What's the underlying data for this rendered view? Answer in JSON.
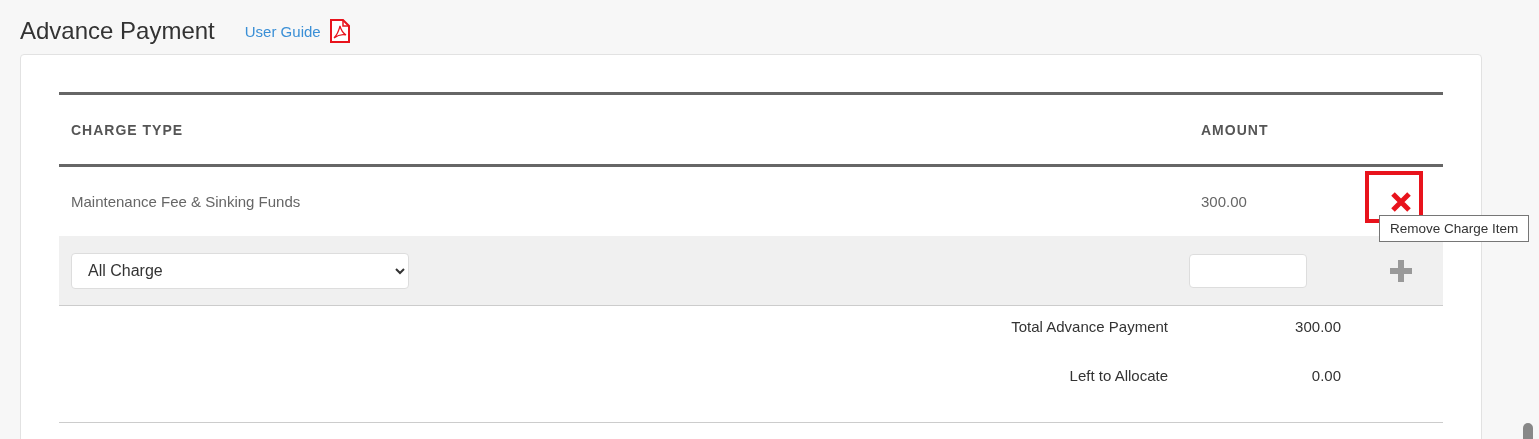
{
  "page": {
    "title": "Advance Payment",
    "guide_link": "User Guide"
  },
  "table": {
    "columns": [
      "CHARGE TYPE",
      "AMOUNT"
    ],
    "rows": [
      {
        "charge_type": "Maintenance Fee & Sinking Funds",
        "amount": "300.00",
        "highlighted": true,
        "tooltip": "Remove Charge Item"
      }
    ],
    "new_row": {
      "charge_select": "All Charge"
    },
    "totals": [
      {
        "label": "Total Advance Payment",
        "value": "300.00"
      },
      {
        "label": "Left to Allocate",
        "value": "0.00"
      }
    ]
  }
}
